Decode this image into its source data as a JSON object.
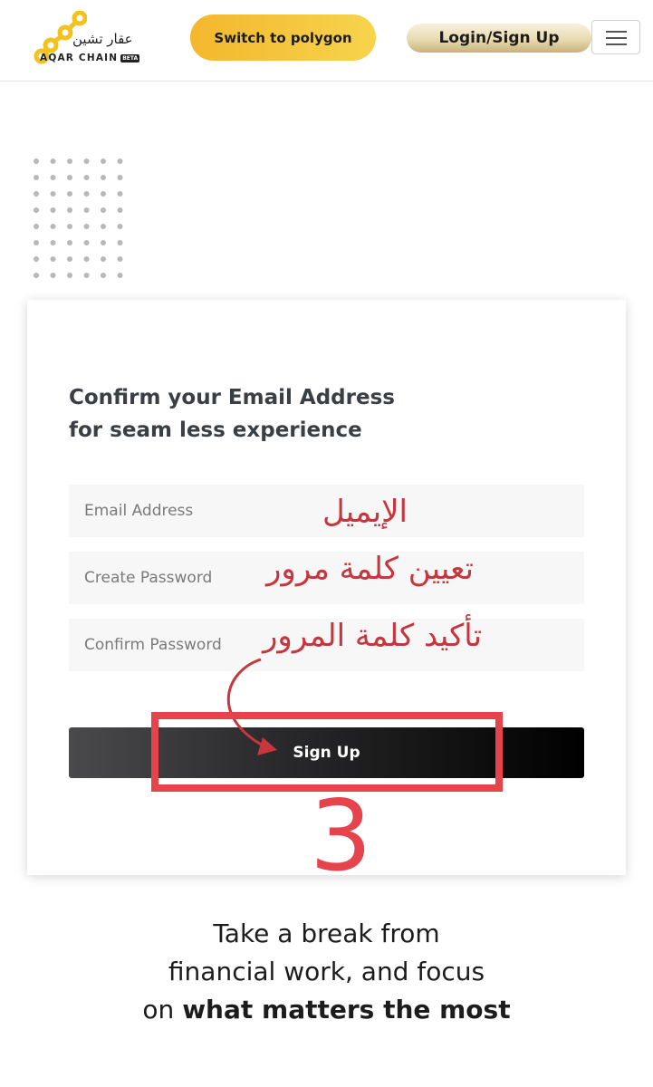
{
  "header": {
    "logo_arabic": "عقار تشين",
    "logo_english": "AQAR CHAIN",
    "logo_badge": "BETA",
    "switch_button": "Switch to polygon",
    "login_button": "Login/Sign Up",
    "menu_icon": "hamburger-menu-icon"
  },
  "card": {
    "title_line1": "Confirm your Email Address",
    "title_line2": "for seam less experience",
    "email_placeholder": "Email Address",
    "password_placeholder": "Create Password",
    "confirm_placeholder": "Confirm Password",
    "signup_button": "Sign Up"
  },
  "annotations": {
    "email_label": "الإيميل",
    "password_label": "تعيين كلمة مرور",
    "confirm_label": "تأكيد كلمة المرور",
    "step_number": "3",
    "color": "#e5444d"
  },
  "tagline": {
    "line1": "Take a break from",
    "line2": "financial work, and focus",
    "line3_prefix": "on ",
    "line3_bold": "what matters the most"
  },
  "colors": {
    "polygon_button": "#f3b72d",
    "login_button": "#e8dbb1",
    "signup_button": "#000000"
  }
}
